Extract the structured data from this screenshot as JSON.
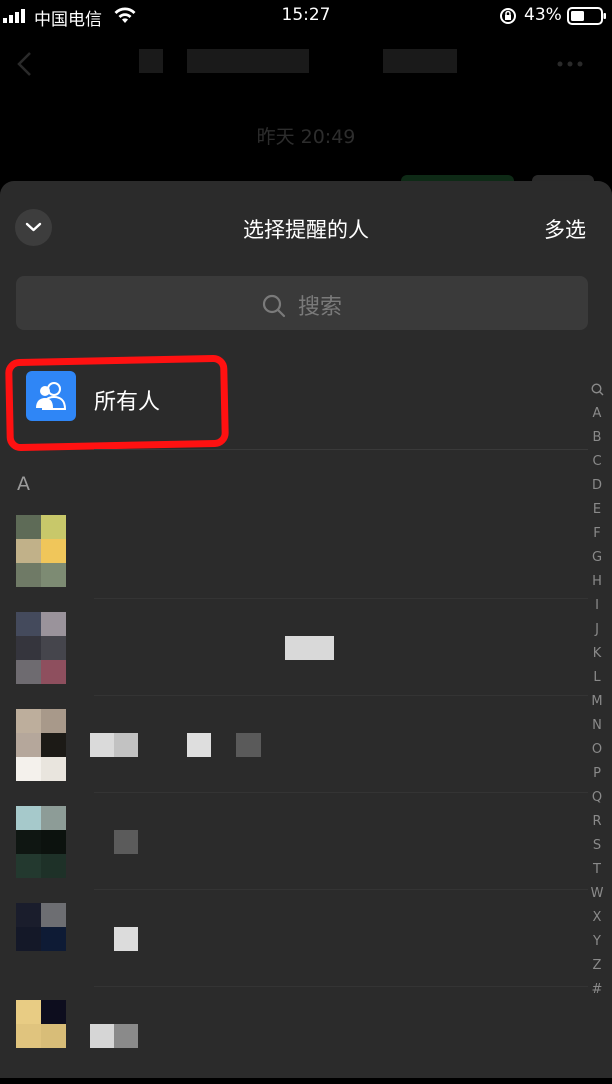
{
  "status_bar": {
    "carrier": "中国电信",
    "time": "15:27",
    "battery": "43%"
  },
  "chat": {
    "timestamp": "昨天 20:49"
  },
  "sheet": {
    "title": "选择提醒的人",
    "multi_select": "多选",
    "search_placeholder": "搜索",
    "everyone": "所有人",
    "section_letter": "A",
    "index": [
      "A",
      "B",
      "C",
      "D",
      "E",
      "F",
      "G",
      "H",
      "I",
      "J",
      "K",
      "L",
      "M",
      "N",
      "O",
      "P",
      "Q",
      "R",
      "S",
      "T",
      "W",
      "X",
      "Y",
      "Z",
      "#"
    ],
    "contacts": [
      {
        "avatar_colors": [
          "#5e6b57",
          "#c8c86a",
          "#c1b189",
          "#f0c65a",
          "#6f7a66",
          "#7d8b73"
        ]
      },
      {
        "avatar_colors": [
          "#444a5c",
          "#9a939b",
          "#35353d",
          "#45454c",
          "#6e6b70",
          "#8e4f5e"
        ]
      },
      {
        "avatar_colors": [
          "#bdae9c",
          "#a8998a",
          "#b5a79b",
          "#1c1a16",
          "#f4f1ec",
          "#e9e5de"
        ]
      },
      {
        "avatar_colors": [
          "#a6c9cb",
          "#8d9c97",
          "#0f1612",
          "#0c120e",
          "#23392f",
          "#1e3128"
        ]
      },
      {
        "avatar_colors": [
          "#1a1d2c",
          "#6d6e72",
          "#141828",
          "#0e1b35",
          "#2b2b2b",
          "#2b2b2b"
        ]
      },
      {
        "avatar_colors": [
          "#e8cc84",
          "#0d0d1e",
          "#e0c47e",
          "#d8bd78",
          "#2b2b2b",
          "#2b2b2b"
        ]
      }
    ]
  },
  "colors": {
    "accent": "#2f86f6",
    "highlight": "#ff1111",
    "sheet_bg": "#2b2b2b"
  }
}
